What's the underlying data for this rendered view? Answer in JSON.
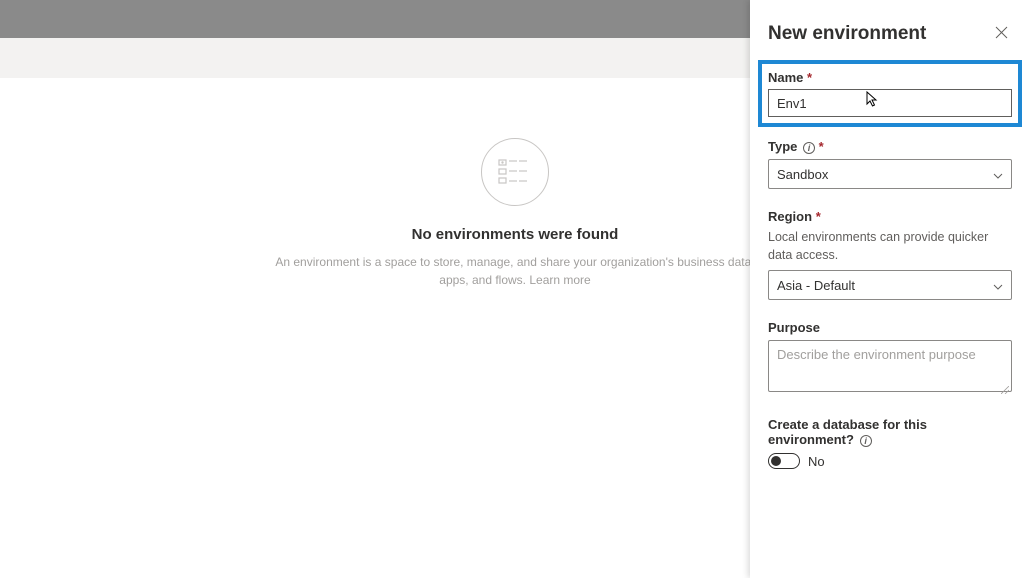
{
  "main": {
    "emptyTitle": "No environments were found",
    "emptyDescLine1": "An environment is a space to store, manage, and share your organization's business data,",
    "emptyDescLine2": "apps, and flows.",
    "learnMore": "Learn more"
  },
  "panel": {
    "title": "New environment",
    "name": {
      "label": "Name",
      "value": "Env1"
    },
    "type": {
      "label": "Type",
      "value": "Sandbox"
    },
    "region": {
      "label": "Region",
      "hint": "Local environments can provide quicker data access.",
      "value": "Asia - Default"
    },
    "purpose": {
      "label": "Purpose",
      "placeholder": "Describe the environment purpose"
    },
    "database": {
      "label": "Create a database for this environment?",
      "value": "No"
    }
  }
}
